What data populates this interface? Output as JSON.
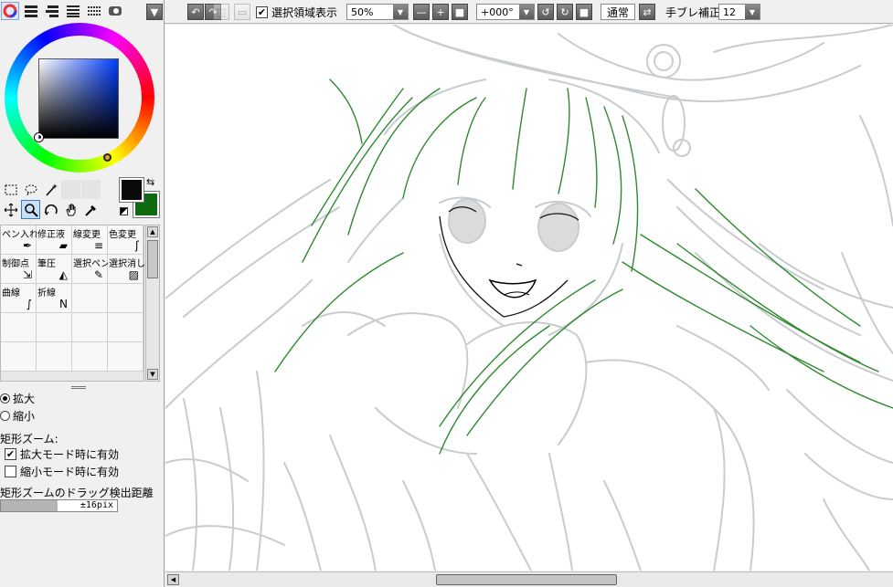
{
  "toolbar": {
    "selection_display_label": "選択領域表示",
    "zoom_value": "50%",
    "rotation_value": "+000°",
    "blend_mode": "通常",
    "stabilizer_label": "手ブレ補正",
    "stabilizer_value": "12",
    "selection_display_checked": true
  },
  "color": {
    "foreground": "#0a0a0a",
    "background": "#0e6a10"
  },
  "brushes": [
    {
      "label": "ペン入れ",
      "icon": "pen-icon"
    },
    {
      "label": "修正液",
      "icon": "eraser-icon"
    },
    {
      "label": "線変更",
      "icon": "line-width-icon"
    },
    {
      "label": "色変更",
      "icon": "recolor-icon"
    },
    {
      "label": "制御点",
      "icon": "control-point-icon"
    },
    {
      "label": "筆圧",
      "icon": "pressure-icon"
    },
    {
      "label": "選択ペン",
      "icon": "select-pen-icon"
    },
    {
      "label": "選択消し",
      "icon": "select-erase-icon"
    },
    {
      "label": "曲線",
      "icon": "curve-icon"
    },
    {
      "label": "折線",
      "icon": "polyline-icon"
    }
  ],
  "zoom_options": {
    "zoom_in_label": "拡大",
    "zoom_out_label": "縮小",
    "zoom_in_selected": true,
    "rect_zoom_heading": "矩形ズーム:",
    "rect_zoom_in_mode_label": "拡大モード時に有効",
    "rect_zoom_in_mode_checked": true,
    "rect_zoom_out_mode_label": "縮小モード時に有効",
    "rect_zoom_out_mode_checked": false,
    "drag_distance_label": "矩形ズームのドラッグ検出距離",
    "drag_distance_value": "±16pix"
  }
}
